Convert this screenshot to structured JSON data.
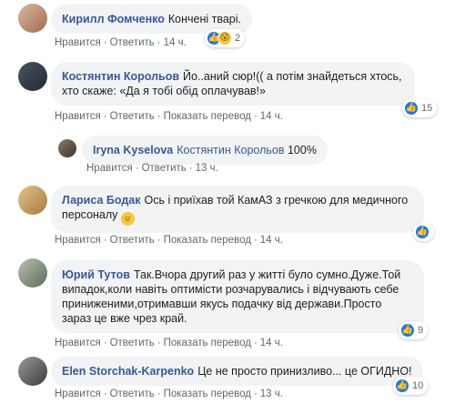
{
  "comments": [
    {
      "author": "Кирилл Фомченко",
      "text": "Кончені тварі.",
      "actions": [
        "Нравится",
        "Ответить",
        "14 ч."
      ],
      "reactions": {
        "icons": [
          "like-icon",
          "wow-icon"
        ],
        "count": "2"
      }
    },
    {
      "author": "Костянтин Корольов",
      "text": "Йо..аний сюр!(( а потім знайдеться хтось, хто скаже: «Да я тобі обід оплачував!»",
      "actions": [
        "Нравится",
        "Ответить",
        "Показать перевод",
        "14 ч."
      ],
      "reactions": {
        "icons": [
          "like-icon"
        ],
        "count": "15"
      }
    },
    {
      "author": "Iryna Kyselova",
      "mention": "Костянтин Корольов",
      "text": "100%",
      "actions": [
        "Нравится",
        "Ответить",
        "13 ч."
      ]
    },
    {
      "author": "Лариса Бодак",
      "text": "Ось і приїхав той КамАЗ з гречкою для медичного персоналу",
      "emoji": "smiling-face-icon",
      "actions": [
        "Нравится",
        "Ответить",
        "Показать перевод",
        "14 ч."
      ],
      "reactions": {
        "icons": [
          "like-icon"
        ],
        "count": ""
      }
    },
    {
      "author": "Юрий Тутов",
      "text": "Так.Вчора другий раз у житті було сумно.Дуже.Той випадок,коли навіть оптимісти розчарувались і відчувають себе приниженими,отримавши якусь подачку від держави.Просто зараз це вже чрез край.",
      "actions": [
        "Нравится",
        "Ответить",
        "Показать перевод",
        "14 ч."
      ],
      "reactions": {
        "icons": [
          "like-icon"
        ],
        "count": "9"
      }
    },
    {
      "author": "Elen Storchak-Karpenko",
      "text": "Це не просто принизливо... це ОГИДНО!",
      "actions": [
        "Нравится",
        "Ответить",
        "Показать перевод",
        "13 ч."
      ],
      "reactions": {
        "icons": [
          "like-icon"
        ],
        "count": "10"
      }
    }
  ],
  "colors": {
    "link": "#385898",
    "bubble": "#f2f3f5",
    "like": "#1877f2",
    "meta": "#606770"
  }
}
